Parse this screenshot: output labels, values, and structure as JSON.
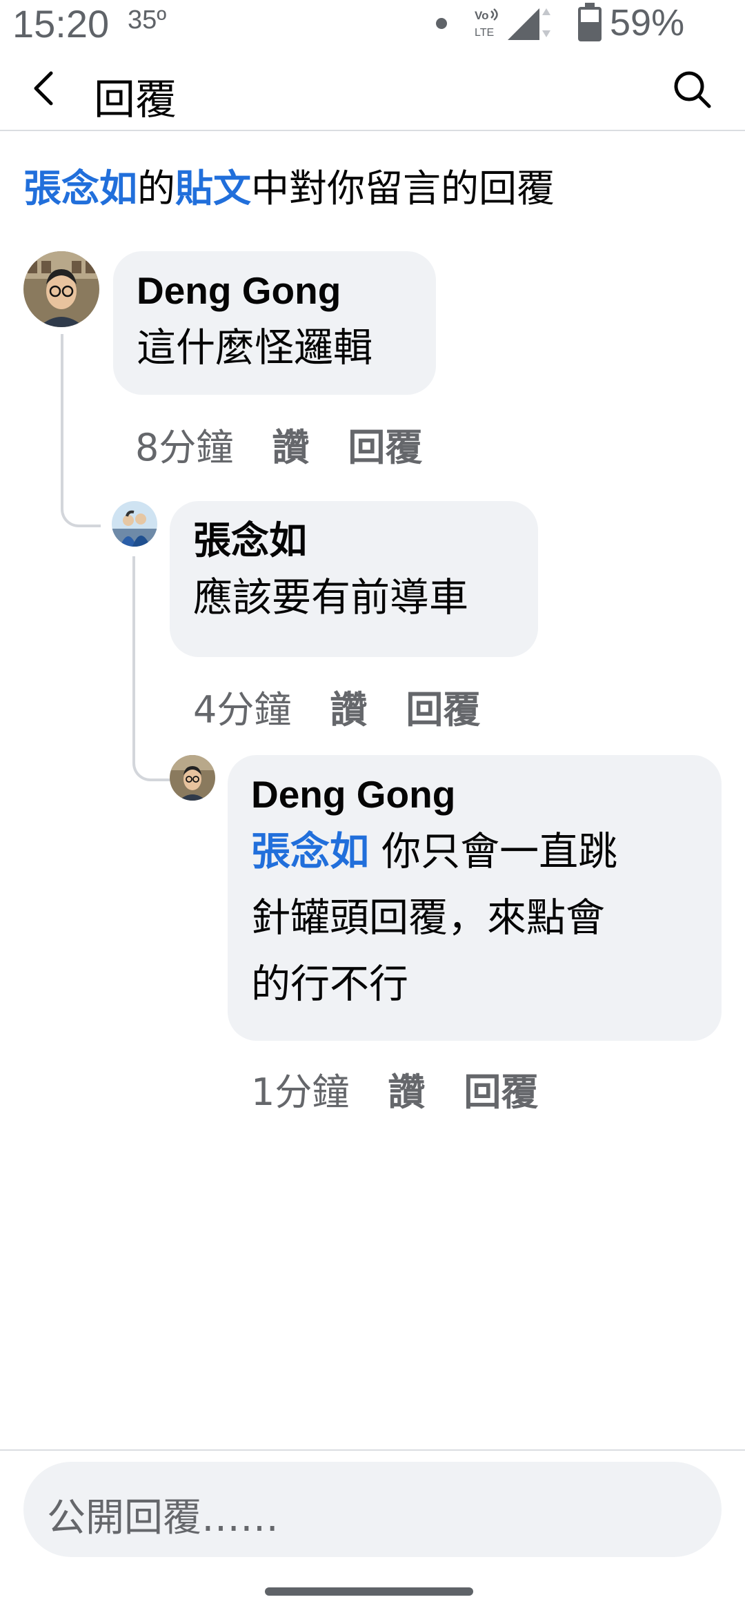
{
  "status_bar": {
    "time": "15:20",
    "temperature": "35º",
    "battery": "59%",
    "network": "Vo LTE"
  },
  "header": {
    "title": "回覆",
    "back_icon": "chevron-left-icon",
    "search_icon": "search-icon"
  },
  "context": {
    "author": "張念如",
    "connector1": "的",
    "post": "貼文",
    "rest": "中對你留言的回覆"
  },
  "comments": [
    {
      "author": "Deng Gong",
      "text": "這什麼怪邏輯",
      "time": "8分鐘",
      "like": "讚",
      "reply": "回覆"
    },
    {
      "author": "張念如",
      "text": "應該要有前導車",
      "time": "4分鐘",
      "like": "讚",
      "reply": "回覆"
    },
    {
      "author": "Deng Gong",
      "mention": "張念如",
      "text_line1": " 你只會一直跳",
      "text_line2": "針罐頭回覆，來點會",
      "text_line3": "的行不行",
      "time": "1分鐘",
      "like": "讚",
      "reply": "回覆"
    }
  ],
  "composer": {
    "placeholder": "公開回覆……"
  },
  "colors": {
    "link": "#216fdb",
    "bubble": "#f0f2f5",
    "meta": "#65676b"
  }
}
